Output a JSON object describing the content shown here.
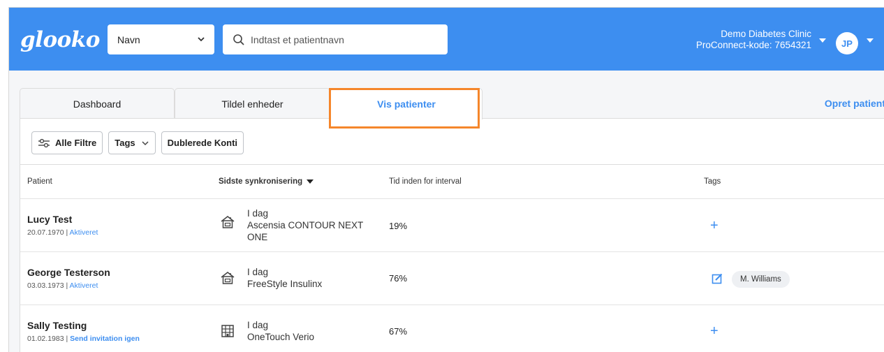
{
  "header": {
    "logo": "glooko",
    "search_type": "Navn",
    "search_placeholder": "Indtast et patientnavn",
    "clinic_name": "Demo Diabetes Clinic",
    "proconnect": "ProConnect-kode: 7654321",
    "avatar_initials": "JP"
  },
  "tabs": {
    "dashboard": "Dashboard",
    "tildel": "Tildel enheder",
    "vis": "Vis patienter",
    "opret": "Opret patient"
  },
  "filters": {
    "alle": "Alle Filtre",
    "tags": "Tags",
    "dublerede": "Dublerede Konti"
  },
  "table": {
    "headers": {
      "patient": "Patient",
      "sync": "Sidste synkronisering",
      "tid": "Tid inden for interval",
      "tags": "Tags"
    },
    "rows": [
      {
        "name": "Lucy Test",
        "dob": "20.07.1970",
        "sep": " | ",
        "status": "Aktiveret",
        "sync_day": "I dag",
        "device_line1": "Ascensia CONTOUR NEXT",
        "device_line2": "ONE",
        "tir": "19%",
        "device_icon": "home-icon"
      },
      {
        "name": "George Testerson",
        "dob": "03.03.1973",
        "sep": " | ",
        "status": "Aktiveret",
        "sync_day": "I dag",
        "device_line1": "FreeStyle Insulinx",
        "tir": "76%",
        "tag": "M. Williams",
        "device_icon": "home-icon"
      },
      {
        "name": "Sally Testing",
        "dob": "01.02.1983",
        "sep": " | ",
        "status": "Send invitation igen",
        "sync_day": "I dag",
        "device_line1": "OneTouch Verio",
        "tir": "67%",
        "device_icon": "building-icon"
      }
    ]
  },
  "colors": {
    "brand": "#3d8ef0",
    "highlight": "#f5862b"
  }
}
